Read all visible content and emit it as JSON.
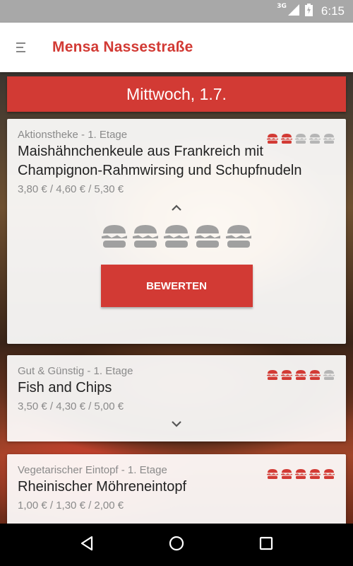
{
  "status_bar": {
    "network": "3G",
    "time": "6:15"
  },
  "app_bar": {
    "title": "Mensa Nassestraße"
  },
  "date_header": "Mittwoch, 1.7.",
  "meals": [
    {
      "location": "Aktionstheke - 1. Etage",
      "name": "Maishähnchenkeule aus Frankreich mit Champignon-Rahmwirsing und Schupfnudeln",
      "prices": "3,80 € / 4,60 € / 5,30 €",
      "rating": 2,
      "expanded": true,
      "rate_label": "BEWERTEN"
    },
    {
      "location": "Gut & Günstig - 1. Etage",
      "name": "Fish and Chips",
      "prices": "3,50 € / 4,30 € / 5,00 €",
      "rating": 4,
      "expanded": false
    },
    {
      "location": "Vegetarischer Eintopf - 1. Etage",
      "name": "Rheinischer Möhreneintopf",
      "prices": "1,00 € / 1,30 € / 2,00 €",
      "rating": 5,
      "expanded": false
    }
  ],
  "rating_max": 5,
  "colors": {
    "accent": "#d23a34",
    "inactive": "#b5b5b5",
    "text": "#222222",
    "muted": "#8a8a8a"
  },
  "icons": [
    "menu-icon",
    "burger-icon",
    "chevron-up-icon",
    "chevron-down-icon",
    "back-icon",
    "home-icon",
    "recents-icon"
  ]
}
